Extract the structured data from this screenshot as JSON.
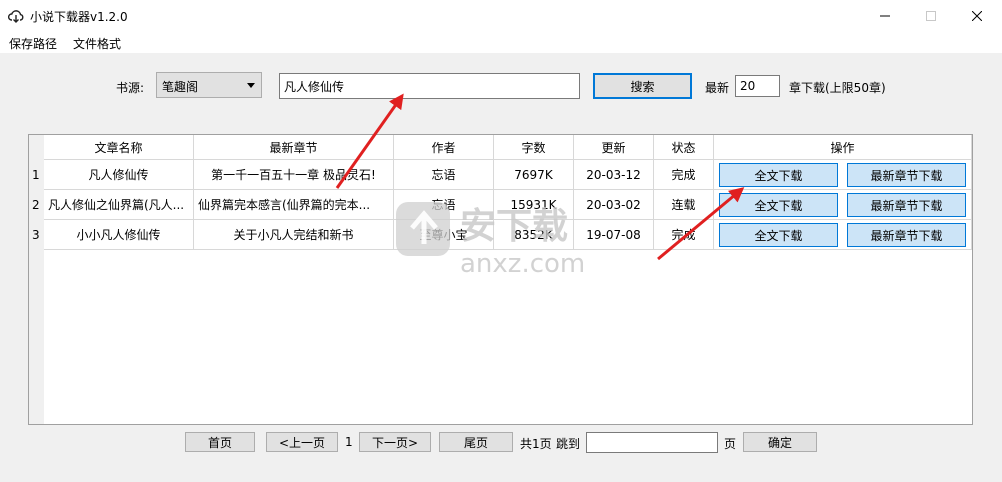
{
  "window": {
    "title": "小说下载器v1.2.0"
  },
  "menu": [
    "保存路径",
    "文件格式"
  ],
  "search": {
    "source_label": "书源:",
    "source_value": "笔趣阁",
    "query": "凡人修仙传",
    "search_button": "搜索",
    "latest_label": "最新",
    "latest_count": "20",
    "latest_suffix": "章下载(上限50章)"
  },
  "table": {
    "headers": [
      "文章名称",
      "最新章节",
      "作者",
      "字数",
      "更新",
      "状态",
      "操作"
    ],
    "rows": [
      {
        "num": "1",
        "name": "凡人修仙传",
        "latest": "第一千一百五十一章 极品灵石!",
        "author": "忘语",
        "words": "7697K",
        "updated": "20-03-12",
        "status": "完成",
        "btn_full": "全文下载",
        "btn_latest": "最新章节下载"
      },
      {
        "num": "2",
        "name": "凡人修仙之仙界篇(凡人...",
        "latest": "仙界篇完本感言(仙界篇的完本...",
        "author": "忘语",
        "words": "15931K",
        "updated": "20-03-02",
        "status": "连载",
        "btn_full": "全文下载",
        "btn_latest": "最新章节下载"
      },
      {
        "num": "3",
        "name": "小小凡人修仙传",
        "latest": "关于小凡人完结和新书",
        "author": "至尊小宝",
        "words": "8352K",
        "updated": "19-07-08",
        "status": "完成",
        "btn_full": "全文下载",
        "btn_latest": "最新章节下载"
      }
    ]
  },
  "pager": {
    "first": "首页",
    "prev": "<上一页",
    "current": "1",
    "next": "下一页>",
    "last": "尾页",
    "total": "共1页",
    "goto_label": "跳到",
    "goto_value": "",
    "page_suffix": "页",
    "confirm": "确定"
  },
  "watermark": {
    "text": "安下载",
    "url": "anxz.com"
  },
  "colors": {
    "arrow": "#e02020",
    "grid_button_bg": "#cce4f7",
    "focus_border": "#0078d7"
  }
}
